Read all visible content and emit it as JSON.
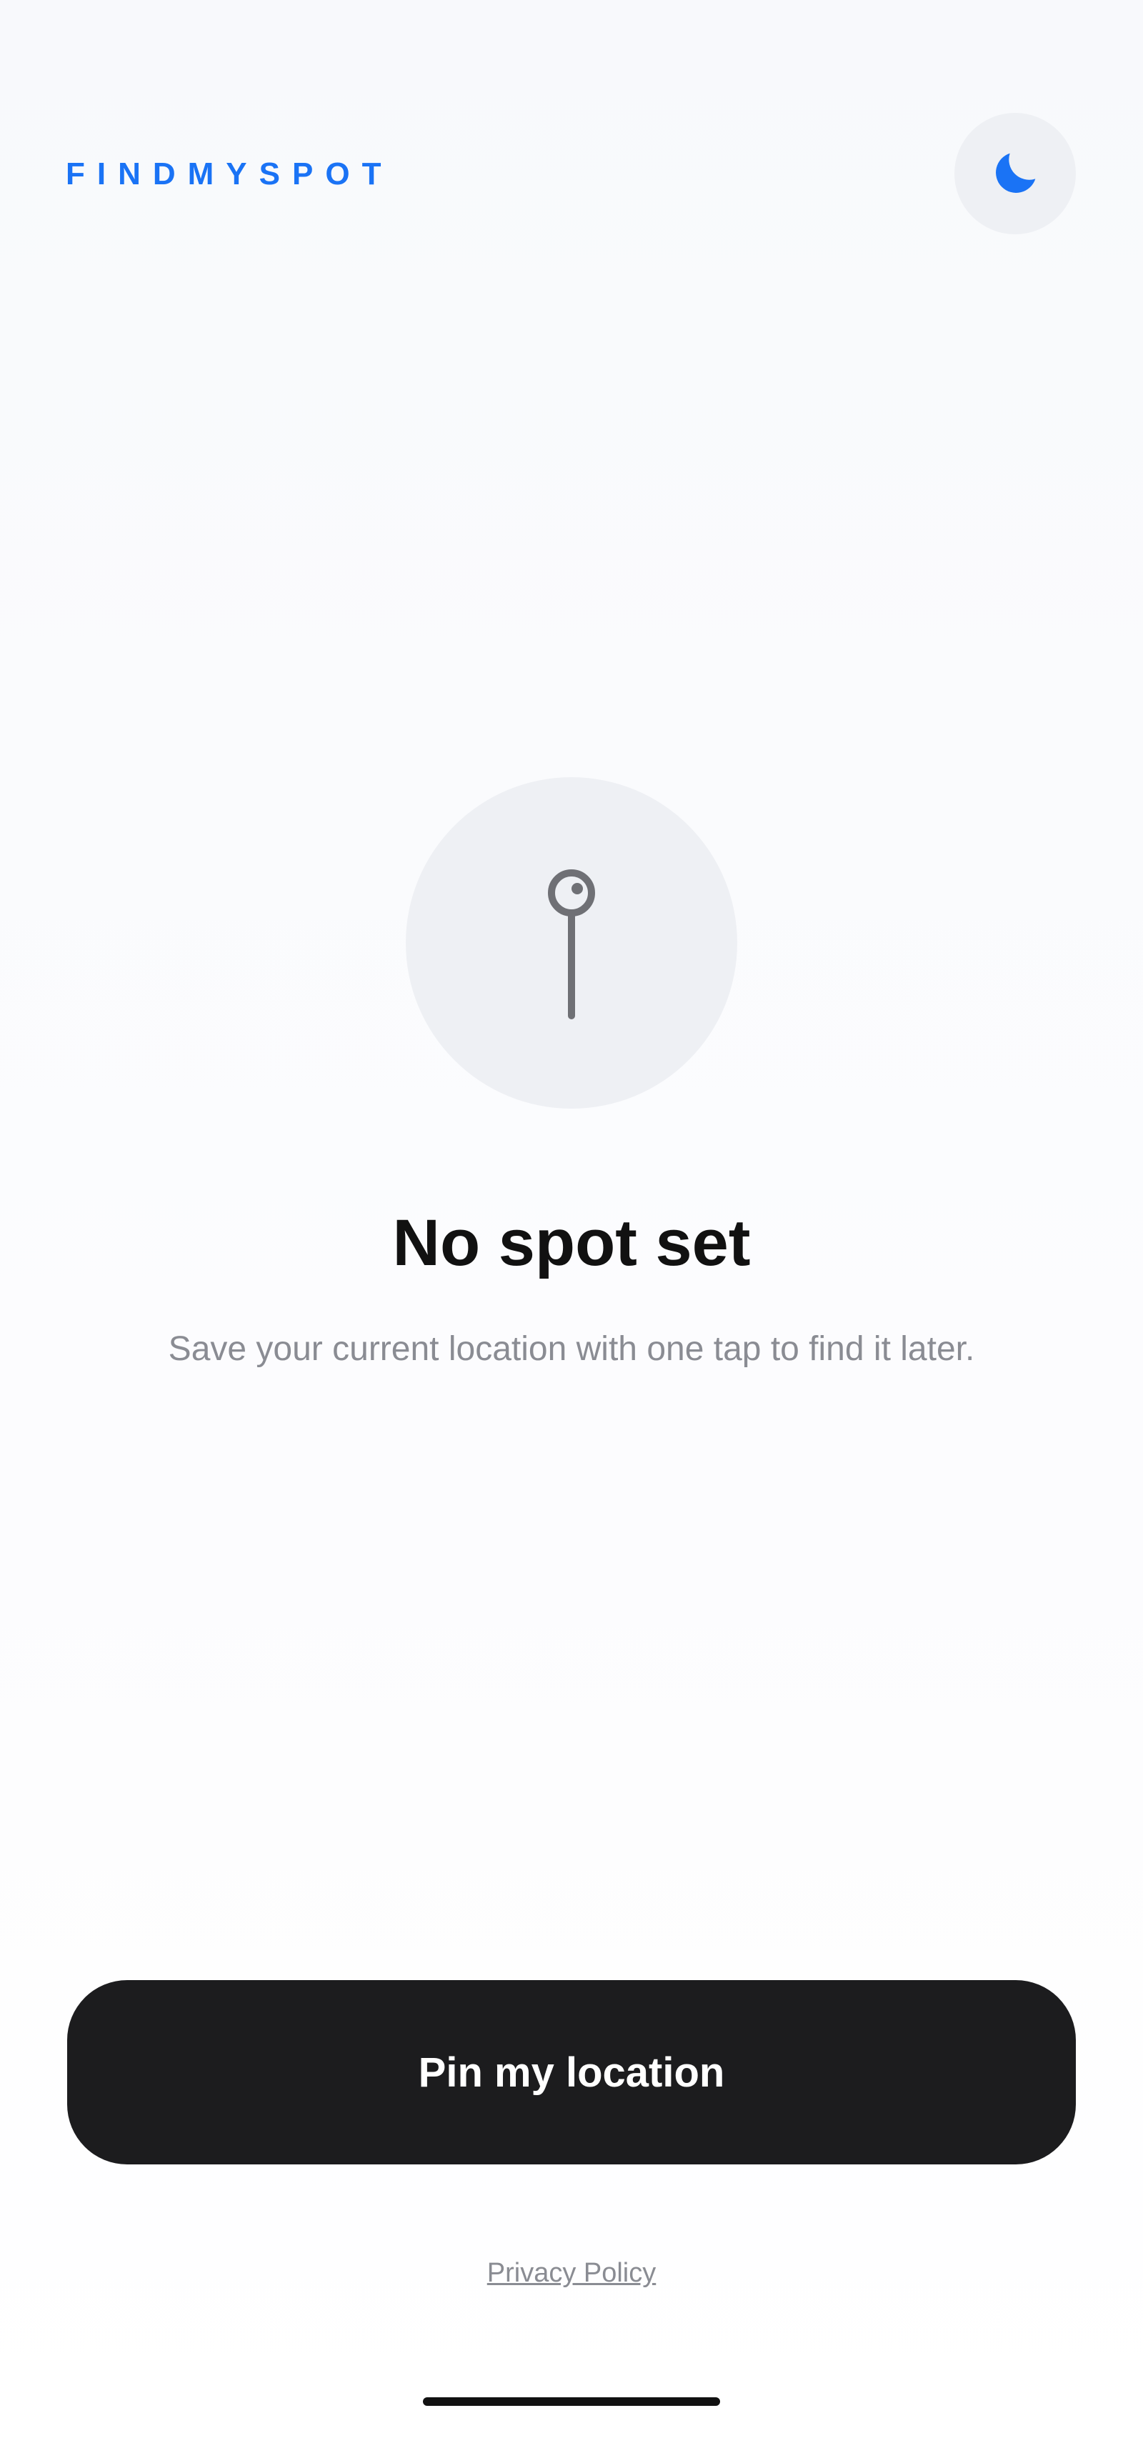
{
  "header": {
    "brand": "FINDMYSPOT",
    "theme_toggle_icon": "moon-icon"
  },
  "empty_state": {
    "icon": "pin-icon",
    "title": "No spot set",
    "subtitle": "Save your current location with one tap to find it later."
  },
  "actions": {
    "pin_button_label": "Pin my location"
  },
  "footer": {
    "privacy_link": "Privacy Policy"
  },
  "colors": {
    "accent": "#1a73f5",
    "button_bg": "#1c1c1e",
    "circle_bg": "#eef0f4",
    "title": "#111111",
    "muted": "#8a8c93"
  }
}
